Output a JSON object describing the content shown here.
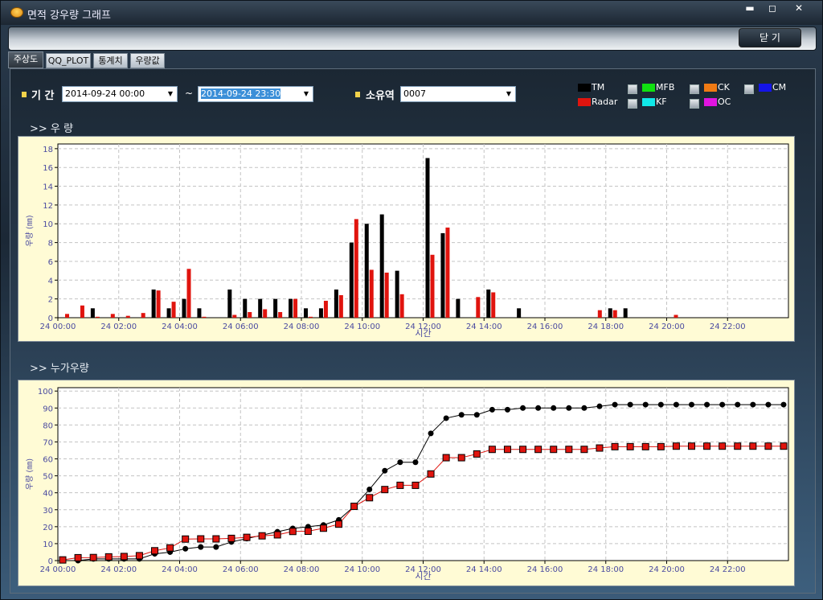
{
  "window": {
    "title": "면적 강우량 그래프",
    "min": "▬",
    "max": "◻",
    "close": "✕"
  },
  "toolbar": {
    "close_label": "닫 기"
  },
  "tabs": [
    "주상도",
    "QQ_PLOT",
    "통계치",
    "우량값"
  ],
  "filters": {
    "period_label": "기 간",
    "start": "2014-09-24 00:00",
    "tilde": "~",
    "end": "2014-09-24 23:30",
    "basin_label": "소유역",
    "basin": "0007"
  },
  "legend": [
    {
      "name": "TM",
      "color": "#000000",
      "checkbox": false
    },
    {
      "name": "Radar",
      "color": "#e0140e",
      "checkbox": false
    },
    {
      "name": "MFB",
      "color": "#10e010",
      "checkbox": true
    },
    {
      "name": "KF",
      "color": "#10e8e8",
      "checkbox": true
    },
    {
      "name": "CK",
      "color": "#f07a14",
      "checkbox": true
    },
    {
      "name": "OC",
      "color": "#e014e0",
      "checkbox": true
    },
    {
      "name": "CM",
      "color": "#1414e8",
      "checkbox": true
    }
  ],
  "sections": {
    "rain": ">> 우   량",
    "cum": ">> 누가우량"
  },
  "chart_data": [
    {
      "type": "bar",
      "ylabel": "우량 (㎜)",
      "xlabel": "시간",
      "ylim": [
        0,
        18.5
      ],
      "yticks": [
        0,
        2,
        4,
        6,
        8,
        10,
        12,
        14,
        16,
        18
      ],
      "xtick_labels": [
        "24 00:00",
        "24 02:00",
        "24 04:00",
        "24 06:00",
        "24 08:00",
        "24 10:00",
        "24 12:00",
        "24 14:00",
        "24 16:00",
        "24 18:00",
        "24 20:00",
        "24 22:00"
      ],
      "grid": true,
      "series": [
        {
          "name": "TM",
          "color": "#000000",
          "values": [
            0,
            0,
            1,
            0,
            0,
            0,
            3,
            1,
            2,
            1,
            0,
            3,
            2,
            2,
            2,
            2,
            1,
            1,
            3,
            8,
            10,
            11,
            5,
            0,
            17,
            9,
            2,
            0,
            3,
            0,
            1,
            0,
            0,
            0,
            0,
            0,
            1,
            1,
            0,
            0,
            0,
            0,
            0,
            0,
            0,
            0,
            0,
            0
          ]
        },
        {
          "name": "Radar",
          "color": "#e0140e",
          "values": [
            0.4,
            1.3,
            0.1,
            0.4,
            0.2,
            0.5,
            2.9,
            1.7,
            5.2,
            0.1,
            0,
            0.3,
            0.6,
            0.9,
            0.6,
            2.0,
            0.1,
            1.8,
            2.4,
            10.5,
            5.1,
            4.8,
            2.5,
            0,
            6.7,
            9.6,
            0,
            2.2,
            2.7,
            0,
            0,
            0,
            0,
            0,
            0,
            0.8,
            0.8,
            0,
            0,
            0,
            0.3,
            0,
            0,
            0,
            0,
            0,
            0,
            0
          ]
        }
      ]
    },
    {
      "type": "line",
      "ylabel": "우량 (㎜)",
      "xlabel": "시간",
      "ylim": [
        0,
        102
      ],
      "yticks": [
        0,
        10,
        20,
        30,
        40,
        50,
        60,
        70,
        80,
        90,
        100
      ],
      "xtick_labels": [
        "24 00:00",
        "24 02:00",
        "24 04:00",
        "24 06:00",
        "24 08:00",
        "24 10:00",
        "24 12:00",
        "24 14:00",
        "24 16:00",
        "24 18:00",
        "24 20:00",
        "24 22:00"
      ],
      "grid": true,
      "series": [
        {
          "name": "TM",
          "color": "#000000",
          "values": [
            0,
            0,
            1,
            1,
            1,
            1,
            4,
            5,
            7,
            8,
            8,
            11,
            13,
            15,
            17,
            19,
            20,
            21,
            24,
            32,
            42,
            53,
            58,
            58,
            75,
            84,
            86,
            86,
            89,
            89,
            90,
            90,
            90,
            90,
            90,
            91,
            92,
            92,
            92,
            92,
            92,
            92,
            92,
            92,
            92,
            92,
            92,
            92
          ]
        },
        {
          "name": "Radar",
          "color": "#e0140e",
          "values": [
            0.4,
            1.7,
            1.8,
            2.2,
            2.4,
            2.9,
            5.8,
            7.5,
            12.7,
            12.8,
            12.8,
            13.1,
            13.7,
            14.6,
            15.2,
            17.2,
            17.3,
            19.1,
            21.5,
            32,
            37.1,
            41.9,
            44.4,
            44.4,
            51.1,
            60.7,
            60.7,
            62.9,
            65.6,
            65.6,
            65.6,
            65.6,
            65.6,
            65.6,
            65.6,
            66.4,
            67.2,
            67.2,
            67.2,
            67.2,
            67.5,
            67.5,
            67.5,
            67.5,
            67.5,
            67.5,
            67.5,
            67.5
          ]
        }
      ]
    }
  ]
}
